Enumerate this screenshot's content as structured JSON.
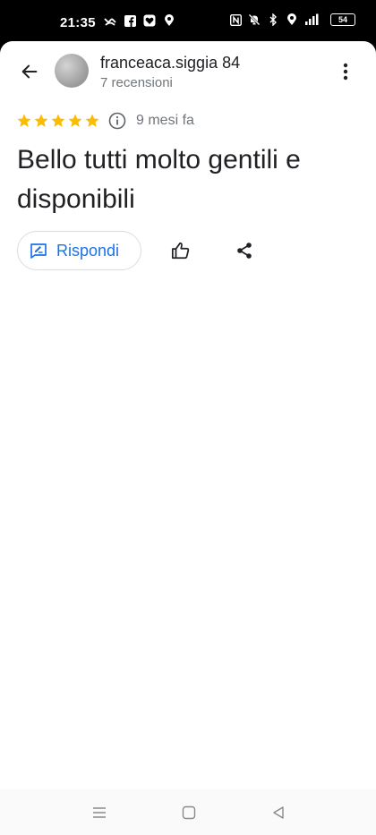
{
  "status_bar": {
    "time": "21:35",
    "battery": "54",
    "left_icons": [
      "missed-call-icon",
      "facebook-icon",
      "heart-app-icon",
      "location-icon"
    ],
    "right_icons": [
      "nfc-icon",
      "mute-icon",
      "bluetooth-icon",
      "location-icon",
      "signal-icon",
      "battery-icon"
    ]
  },
  "header": {
    "user_name": "franceaca.siggia 84",
    "reviews_count": "7 recensioni",
    "back_icon": "arrow-back-icon",
    "more_icon": "more-vert-icon"
  },
  "review": {
    "rating": 5,
    "max_rating": 5,
    "date": "9 mesi fa",
    "text": "Bello tutti molto gentili e disponibili"
  },
  "actions": {
    "reply_label": "Rispondi",
    "reply_icon": "reply-edit-icon",
    "like_icon": "thumb-up-icon",
    "share_icon": "share-icon"
  },
  "nav_bar": {
    "buttons": [
      "menu-icon",
      "home-icon",
      "back-icon"
    ]
  },
  "colors": {
    "star": "#fbbc04",
    "accent": "#1a73e8",
    "text_primary": "#202124",
    "text_secondary": "#70757a"
  }
}
